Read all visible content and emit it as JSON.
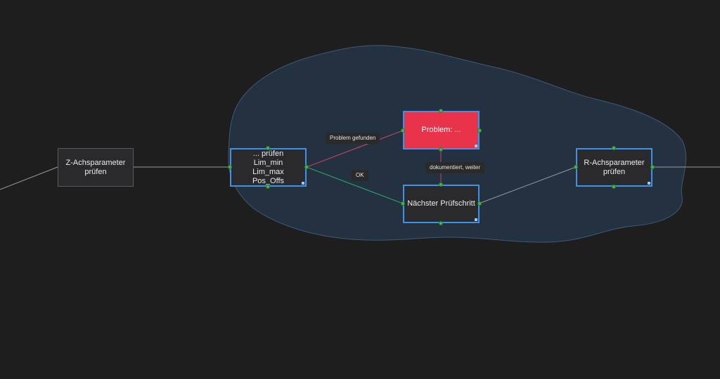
{
  "colors": {
    "background": "#1e1e1e",
    "group_fill": "#243140",
    "group_stroke": "#3d5a78",
    "node_fill": "#2a2a2c",
    "selection": "#3f92e6",
    "problem_node": "#e8334a",
    "handle": "#44b548",
    "edge_default": "#9a9a9a",
    "edge_problem": "#c2425f",
    "edge_ok": "#2c9f63"
  },
  "nodes": {
    "z_axis": {
      "label": "Z-Achsparameter\nprüfen"
    },
    "check": {
      "label": "... prüfen\nLim_min\nLim_max\nPos_Offs"
    },
    "problem": {
      "label": "Problem: ..."
    },
    "next_step": {
      "label": "Nächster Prüfschritt"
    },
    "r_axis": {
      "label": "R-Achsparameter\nprüfen"
    }
  },
  "edges": {
    "problem_found": {
      "label": "Problem gefunden"
    },
    "ok": {
      "label": "OK"
    },
    "documented": {
      "label": "dokumentiert, weiter"
    }
  }
}
